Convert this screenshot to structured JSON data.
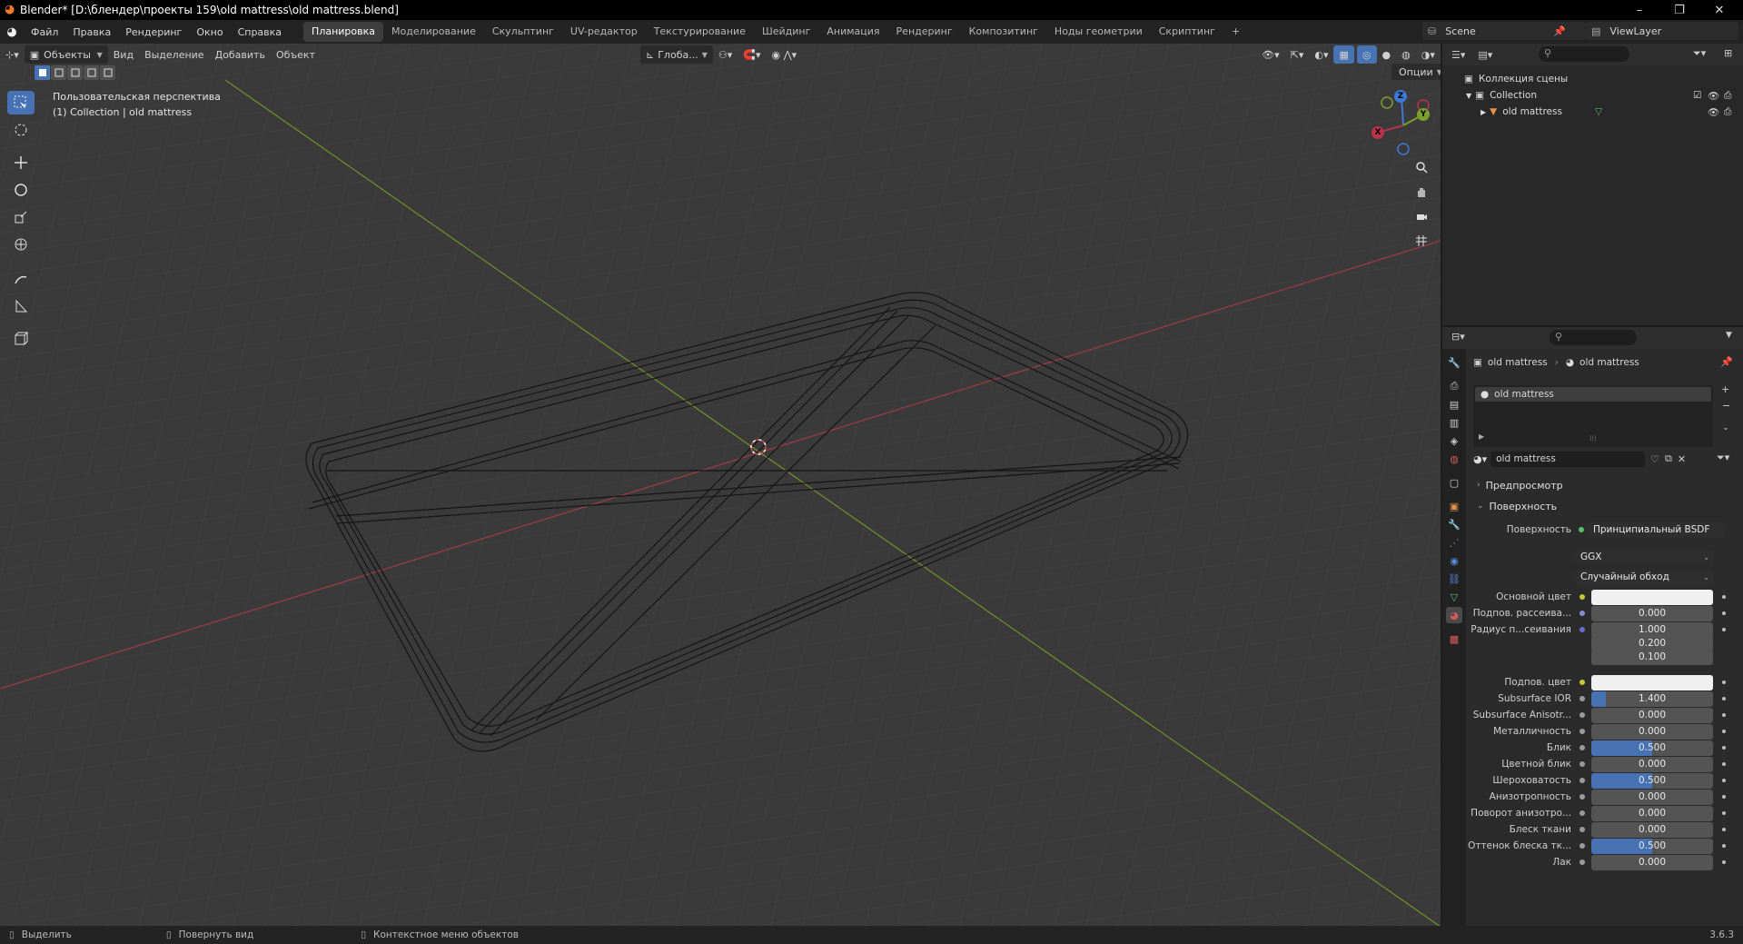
{
  "window": {
    "title": "Blender* [D:\\блендер\\проекты 159\\old mattress\\old mattress.blend]",
    "minimize": "–",
    "maximize": "❐",
    "close": "✕"
  },
  "menu": [
    "Файл",
    "Правка",
    "Рендеринг",
    "Окно",
    "Справка"
  ],
  "workspaces": {
    "tabs": [
      "Планировка",
      "Моделирование",
      "Скульптинг",
      "UV-редактор",
      "Текстурирование",
      "Шейдинг",
      "Анимация",
      "Рендеринг",
      "Композитинг",
      "Ноды геометрии",
      "Скриптинг"
    ],
    "active_index": 0,
    "add": "+"
  },
  "scene": {
    "label": "Scene",
    "viewlayer": "ViewLayer"
  },
  "viewport_header": {
    "mode": "Объекты",
    "menus": [
      "Вид",
      "Выделение",
      "Добавить",
      "Объект"
    ],
    "transform": "Глоба...",
    "options": "Опции"
  },
  "viewport": {
    "perspective": "Пользовательская перспектива",
    "collection_info": "(1) Collection | old mattress",
    "gizmo": {
      "z": "Z",
      "y": "Y",
      "x": "X"
    }
  },
  "outliner": {
    "scene_collection": "Коллекция сцены",
    "collection": "Collection",
    "object": "old mattress"
  },
  "properties": {
    "breadcrumb_object": "old mattress",
    "breadcrumb_material": "old mattress",
    "slot_name": "old mattress",
    "material_name": "old mattress",
    "sections": {
      "preview": "Предпросмотр",
      "surface": "Поверхность"
    },
    "surface_label": "Поверхность",
    "surface_shader": "Принципиальный BSDF",
    "distribution": "GGX",
    "subsurface_method": "Случайный обход",
    "rows": [
      {
        "label": "Основной цвет",
        "type": "color",
        "dot": "#c6c63a"
      },
      {
        "label": "Подпов. рассеива...",
        "value": "0.000",
        "fill": 0,
        "dot": "#8c8cd0"
      },
      {
        "label": "Радиус п...сеивания",
        "value": "1.000",
        "fill": 0,
        "dot": "#6a6ad6"
      },
      {
        "label": "",
        "value": "0.200",
        "fill": 0
      },
      {
        "label": "",
        "value": "0.100",
        "fill": 0
      },
      {
        "label": "Подпов. цвет",
        "type": "color",
        "dot": "#c6c63a"
      },
      {
        "label": "Subsurface IOR",
        "value": "1.400",
        "fill": 0.12,
        "dot": "#9b9b9b"
      },
      {
        "label": "Subsurface Anisotr...",
        "value": "0.000",
        "fill": 0,
        "dot": "#9b9b9b"
      },
      {
        "label": "Металличность",
        "value": "0.000",
        "fill": 0,
        "dot": "#9b9b9b"
      },
      {
        "label": "Блик",
        "value": "0.500",
        "fill": 0.5,
        "dot": "#9b9b9b"
      },
      {
        "label": "Цветной блик",
        "value": "0.000",
        "fill": 0,
        "dot": "#9b9b9b"
      },
      {
        "label": "Шероховатость",
        "value": "0.500",
        "fill": 0.5,
        "dot": "#9b9b9b"
      },
      {
        "label": "Анизотропность",
        "value": "0.000",
        "fill": 0,
        "dot": "#9b9b9b"
      },
      {
        "label": "Поворот анизотро...",
        "value": "0.000",
        "fill": 0,
        "dot": "#9b9b9b"
      },
      {
        "label": "Блеск ткани",
        "value": "0.000",
        "fill": 0,
        "dot": "#9b9b9b"
      },
      {
        "label": "Оттенок блеска тк...",
        "value": "0.500",
        "fill": 0.5,
        "dot": "#9b9b9b"
      },
      {
        "label": "Лак",
        "value": "0.000",
        "fill": 0,
        "dot": "#9b9b9b"
      }
    ]
  },
  "statusbar": {
    "select": "Выделить",
    "rotate": "Повернуть вид",
    "context": "Контекстное меню объектов",
    "version": "3.6.3"
  },
  "colors": {
    "accent": "#4772b3",
    "x_axis": "#b8334a",
    "y_axis": "#7ba02b",
    "z_axis": "#3d79d6",
    "viewport_bg": "#3a3a3a"
  }
}
